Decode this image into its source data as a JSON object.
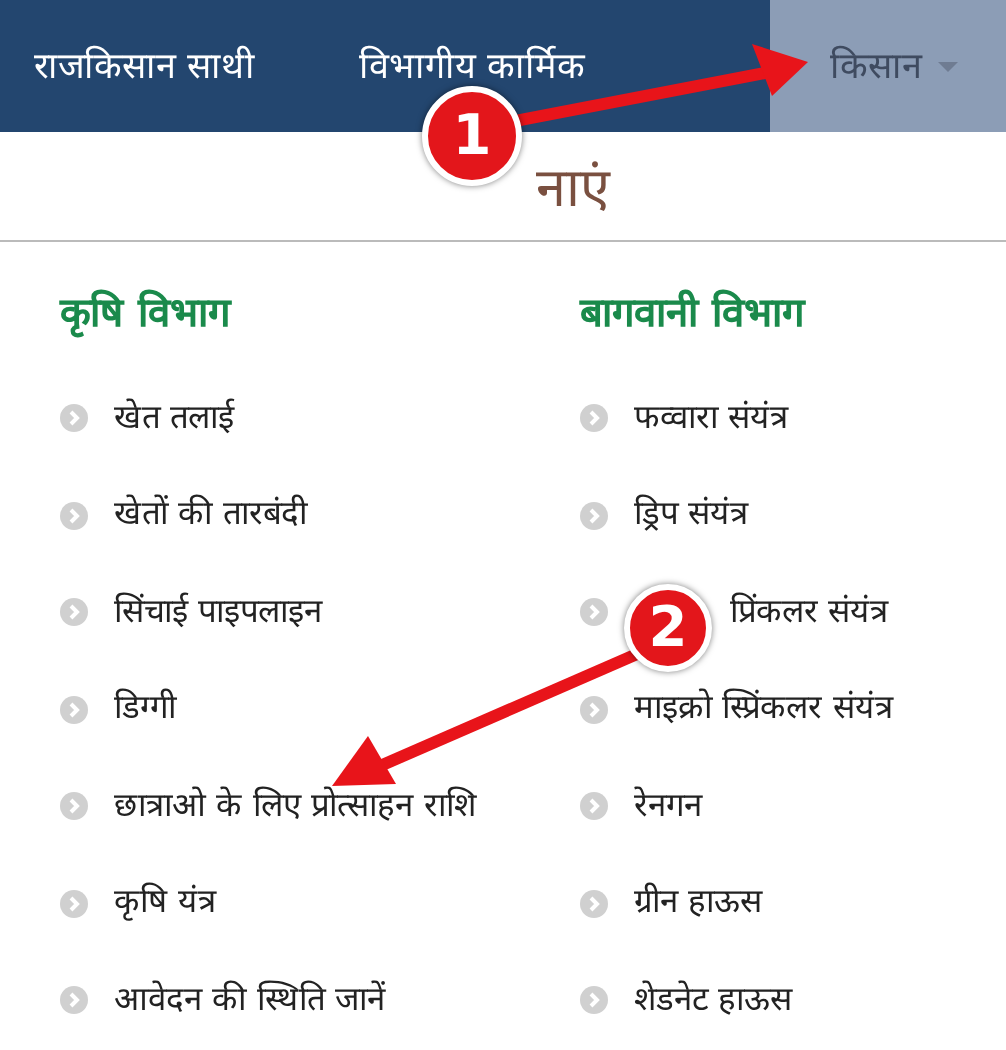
{
  "nav": [
    {
      "label": "राजकिसान साथी",
      "selected": false,
      "dropdown": false
    },
    {
      "label": "विभागीय कार्मिक",
      "selected": false,
      "dropdown": false
    },
    {
      "label": "किसान",
      "selected": true,
      "dropdown": true
    }
  ],
  "heading": "नाएं",
  "columns": [
    {
      "title": "कृषि विभाग",
      "items": [
        "खेत तलाई",
        "खेतों की तारबंदी",
        "सिंचाई पाइपलाइन",
        "डिग्गी",
        "छात्राओ के लिए प्रोत्साहन राशि",
        "कृषि यंत्र",
        "आवेदन की स्थिति जानें"
      ]
    },
    {
      "title": "बागवानी विभाग",
      "items": [
        "फव्वारा संयंत्र",
        "ड्रिप संयंत्र",
        "प्रिंकलर संयंत्र",
        "माइक्रो स्प्रिंकलर संयंत्र",
        "रेनगन",
        "ग्रीन हाऊस",
        "शेडनेट हाऊस"
      ]
    }
  ],
  "annotations": [
    {
      "label": "1"
    },
    {
      "label": "2"
    }
  ]
}
